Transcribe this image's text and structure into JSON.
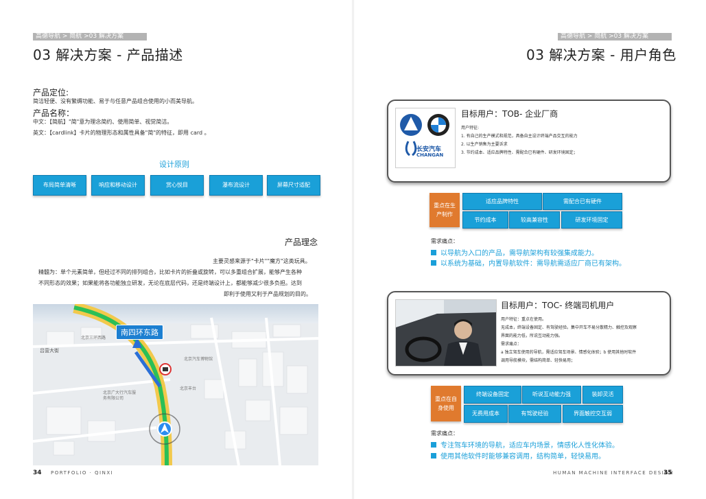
{
  "left": {
    "breadcrumb": "高德导航 > 简航 >03 解决方案",
    "title": "03 解决方案 - 产品描述",
    "positioning_label": "产品定位:",
    "positioning_text": "简洁轻便、没有繁缛功能、易于与任意产品组合使用的小而美导航。",
    "name_label": "产品名称：",
    "name_cn": "中文：【简航】\"简\"意为理念简约、使用简单、视觉简洁。",
    "name_en": "英文：【cardlink】卡片的物理形态和属性具备\"简\"的特征，即用 card 。",
    "design_title": "设计原则",
    "principles": [
      "布局简单清晰",
      "响应和移动设计",
      "赏心悦目",
      "瀑布流设计",
      "屏幕尺寸适配"
    ],
    "concept_title": "产品理念",
    "concept_lines": [
      "主要灵感来源于\"卡片\"\"魔方\"这类玩具。",
      "精髓为：单个元素简单，但经过不同的排列组合，比如卡片的折叠或旋转，可以多重组合扩展，能够产生各种",
      "不同形态的效果；如果能将各功能独立研发，无论在底层代码，还是终端设计上，都能够减少很多负担。达到",
      "即利于使用又利于产品规划的目的。"
    ],
    "map": {
      "road_label": "南四环东路",
      "poi_labels": [
        "吕营大街",
        "北京三环西路",
        "南四环东路",
        "北京汽车博物馆",
        "北京丰台",
        "北京广大行汽车服务有限公司"
      ]
    },
    "page_number": "34",
    "footer": "PORTFOLIO · QINXI"
  },
  "right": {
    "breadcrumb": "高德导航 > 简航 >03 解决方案",
    "title": "03 解决方案 - 用户角色",
    "tob": {
      "title": "目标用户：TOB- 企业厂商",
      "logo_text": "长安汽车",
      "logo_sub": "CHANGAN",
      "lines": [
        "用户特征:",
        "1. 有自己的生产模式和规范，具备自主设计终端产品交互的能力",
        "2. 以生产销售为主要诉求",
        "3. 节约成本、适应品牌特性、需配合已有硬件、研发环境固定；"
      ],
      "focus": "重点在生产制作",
      "tags": [
        "适应品牌特性",
        "需配合已有硬件",
        "节约成本",
        "较高兼容性",
        "研发环境固定"
      ],
      "needs_title": "需求痛点：",
      "needs": [
        "以导航为入口的产品，需导航架构有较强集成能力。",
        "以系统为基础，内置导航软件：需导航需适应厂商已有架构。"
      ]
    },
    "toc": {
      "title": "目标用户：TOC- 终端司机用户",
      "lines": [
        "用户特征：重点在使用。",
        "无成本，终端设备固定、有驾驶经验。集中开车不易分散精力、触控及观察",
        "界面的能力低，所说互动能力强。",
        "需求痛点：",
        "a 独立驾车使用的导航，需适应驾车场景、情感化体验；b 使用其他时软件",
        "调用导航模块，需结构简单、轻快易用；"
      ],
      "focus": "重点在自身使用",
      "tags": [
        "终端设备固定",
        "听说互动能力强",
        "装卸灵活",
        "无费用成本",
        "有驾驶经验",
        "界面触控交互弱"
      ],
      "needs_title": "需求痛点：",
      "needs": [
        "专注驾车环境的导航，适应车内场景，情感化人性化体验。",
        "使用其他软件时能够兼容调用，结构简单，轻快易用。"
      ]
    },
    "page_number": "35",
    "footer": "HUMAN MACHINE INTERFACE DESIGN"
  }
}
